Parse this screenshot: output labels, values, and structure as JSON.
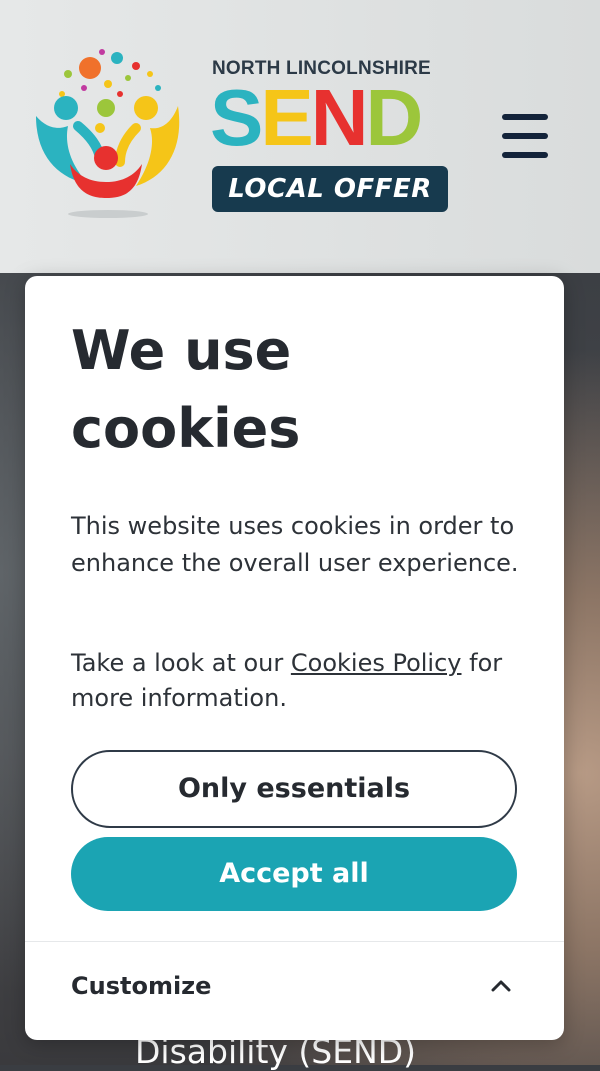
{
  "header": {
    "org_name": "NORTH LINCOLNSHIRE",
    "send_letters": [
      "S",
      "E",
      "N",
      "D"
    ],
    "send_colors": [
      "#2bb3c0",
      "#f5c518",
      "#e7312f",
      "#9cc63b"
    ],
    "local_offer": "LOCAL OFFER",
    "menu_icon": "hamburger-menu-icon"
  },
  "hero": {
    "visible_text": "Disability (SEND)"
  },
  "cookie_modal": {
    "title": "We use cookies",
    "description": "This website uses cookies in order to enhance the overall user experience.",
    "policy_prefix": "Take a look at our ",
    "policy_link": "Cookies Policy",
    "policy_suffix": " for more information.",
    "only_essentials": "Only essentials",
    "accept_all": "Accept all",
    "customize": "Customize",
    "customize_icon": "chevron-up-icon"
  },
  "colors": {
    "accent": "#1ba4b3",
    "header_badge": "#173a4e",
    "text_dark": "#262a30"
  }
}
